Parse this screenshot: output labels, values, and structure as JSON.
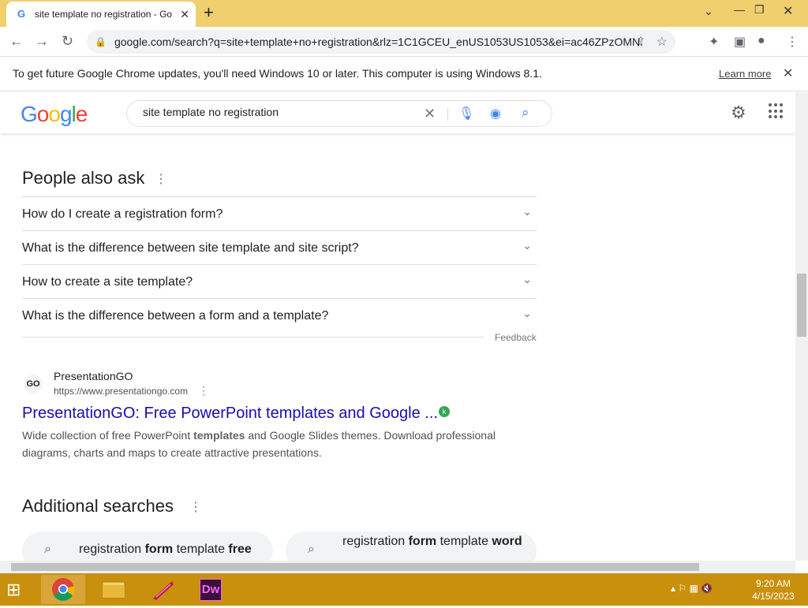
{
  "browser": {
    "tab_title": "site template no registration - Go",
    "url": "google.com/search?q=site+template+no+registration&rlz=1C1GCEU_enUS1053US1053&ei=ac46ZPzOMN...",
    "infobar_message": "To get future Google Chrome updates, you'll need Windows 10 or later. This computer is using Windows 8.1.",
    "infobar_link": "Learn more"
  },
  "google": {
    "logo": "Google",
    "query": "site template no registration"
  },
  "people_also_ask": {
    "title": "People also ask",
    "questions": [
      "How do I create a registration form?",
      "What is the difference between site template and site script?",
      "How to create a site template?",
      "What is the difference between a form and a template?"
    ],
    "feedback": "Feedback"
  },
  "result": {
    "site_name": "PresentationGO",
    "url": "https://www.presentationgo.com",
    "title": "PresentationGO: Free PowerPoint templates and Google ...",
    "snippet_a": "Wide collection of free PowerPoint ",
    "snippet_bold": "templates",
    "snippet_b": " and Google Slides themes. Download professional diagrams, charts and maps to create attractive presentations."
  },
  "additional_searches": {
    "title": "Additional searches",
    "chips": [
      {
        "a": "registration ",
        "b": "form",
        "c": " template ",
        "d": "free"
      },
      {
        "a": "registration ",
        "b": "form",
        "c": " template ",
        "d": "word"
      }
    ]
  },
  "taskbar": {
    "time": "9:20 AM",
    "date": "4/15/2023",
    "apps": [
      "chrome",
      "file-explorer",
      "app-3",
      "dreamweaver"
    ],
    "dw_label": "Dw"
  }
}
